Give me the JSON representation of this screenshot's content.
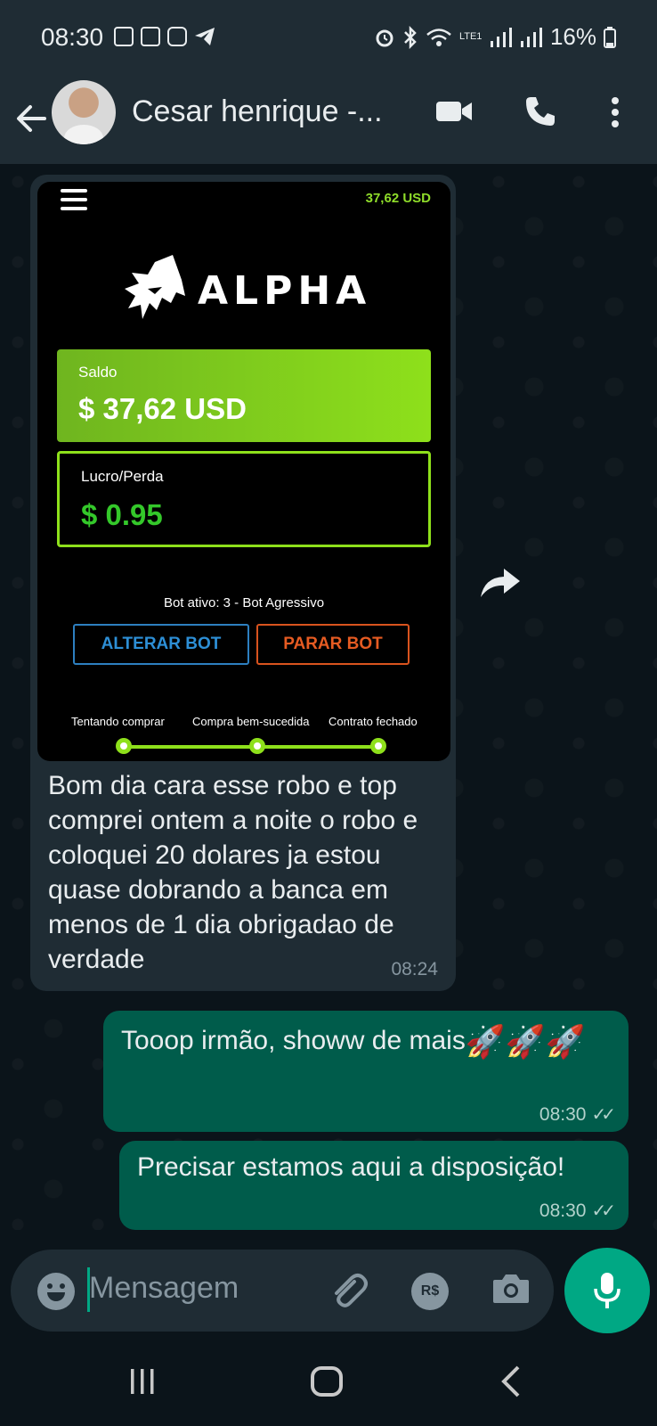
{
  "status_bar": {
    "time": "08:30",
    "network": "LTE1",
    "battery": "16%"
  },
  "header": {
    "title": "Cesar henrique -..."
  },
  "screenshot_in_bubble": {
    "top_balance": "37,62 USD",
    "logo_text": "ALPHA",
    "saldo_label": "Saldo",
    "saldo_value": "$ 37,62 USD",
    "lucro_label": "Lucro/Perda",
    "lucro_value": "$ 0.95",
    "bot_active": "Bot ativo: 3 - Bot Agressivo",
    "alter_button": "ALTERAR BOT",
    "stop_button": "PARAR BOT",
    "steps": [
      "Tentando comprar",
      "Compra bem-sucedida",
      "Contrato fechado"
    ]
  },
  "messages": {
    "incoming": {
      "text": "Bom dia cara esse robo e top comprei ontem a noite o robo e coloquei 20 dolares ja estou quase dobrando a banca em menos de 1 dia obrigadao de verdade",
      "time": "08:24"
    },
    "outgoing": [
      {
        "text": "Tooop irmão, showw de mais",
        "emoji": "🚀🚀🚀",
        "time": "08:30"
      },
      {
        "text": "Precisar estamos aqui a disposição!",
        "time": "08:30"
      }
    ]
  },
  "input": {
    "placeholder": "Mensagem",
    "currency_label": "R$"
  },
  "colors": {
    "accent": "#00a884",
    "outgoing_bubble": "#005c4b",
    "incoming_bubble": "#1f2c34",
    "alpha_green": "#8ee01b"
  }
}
